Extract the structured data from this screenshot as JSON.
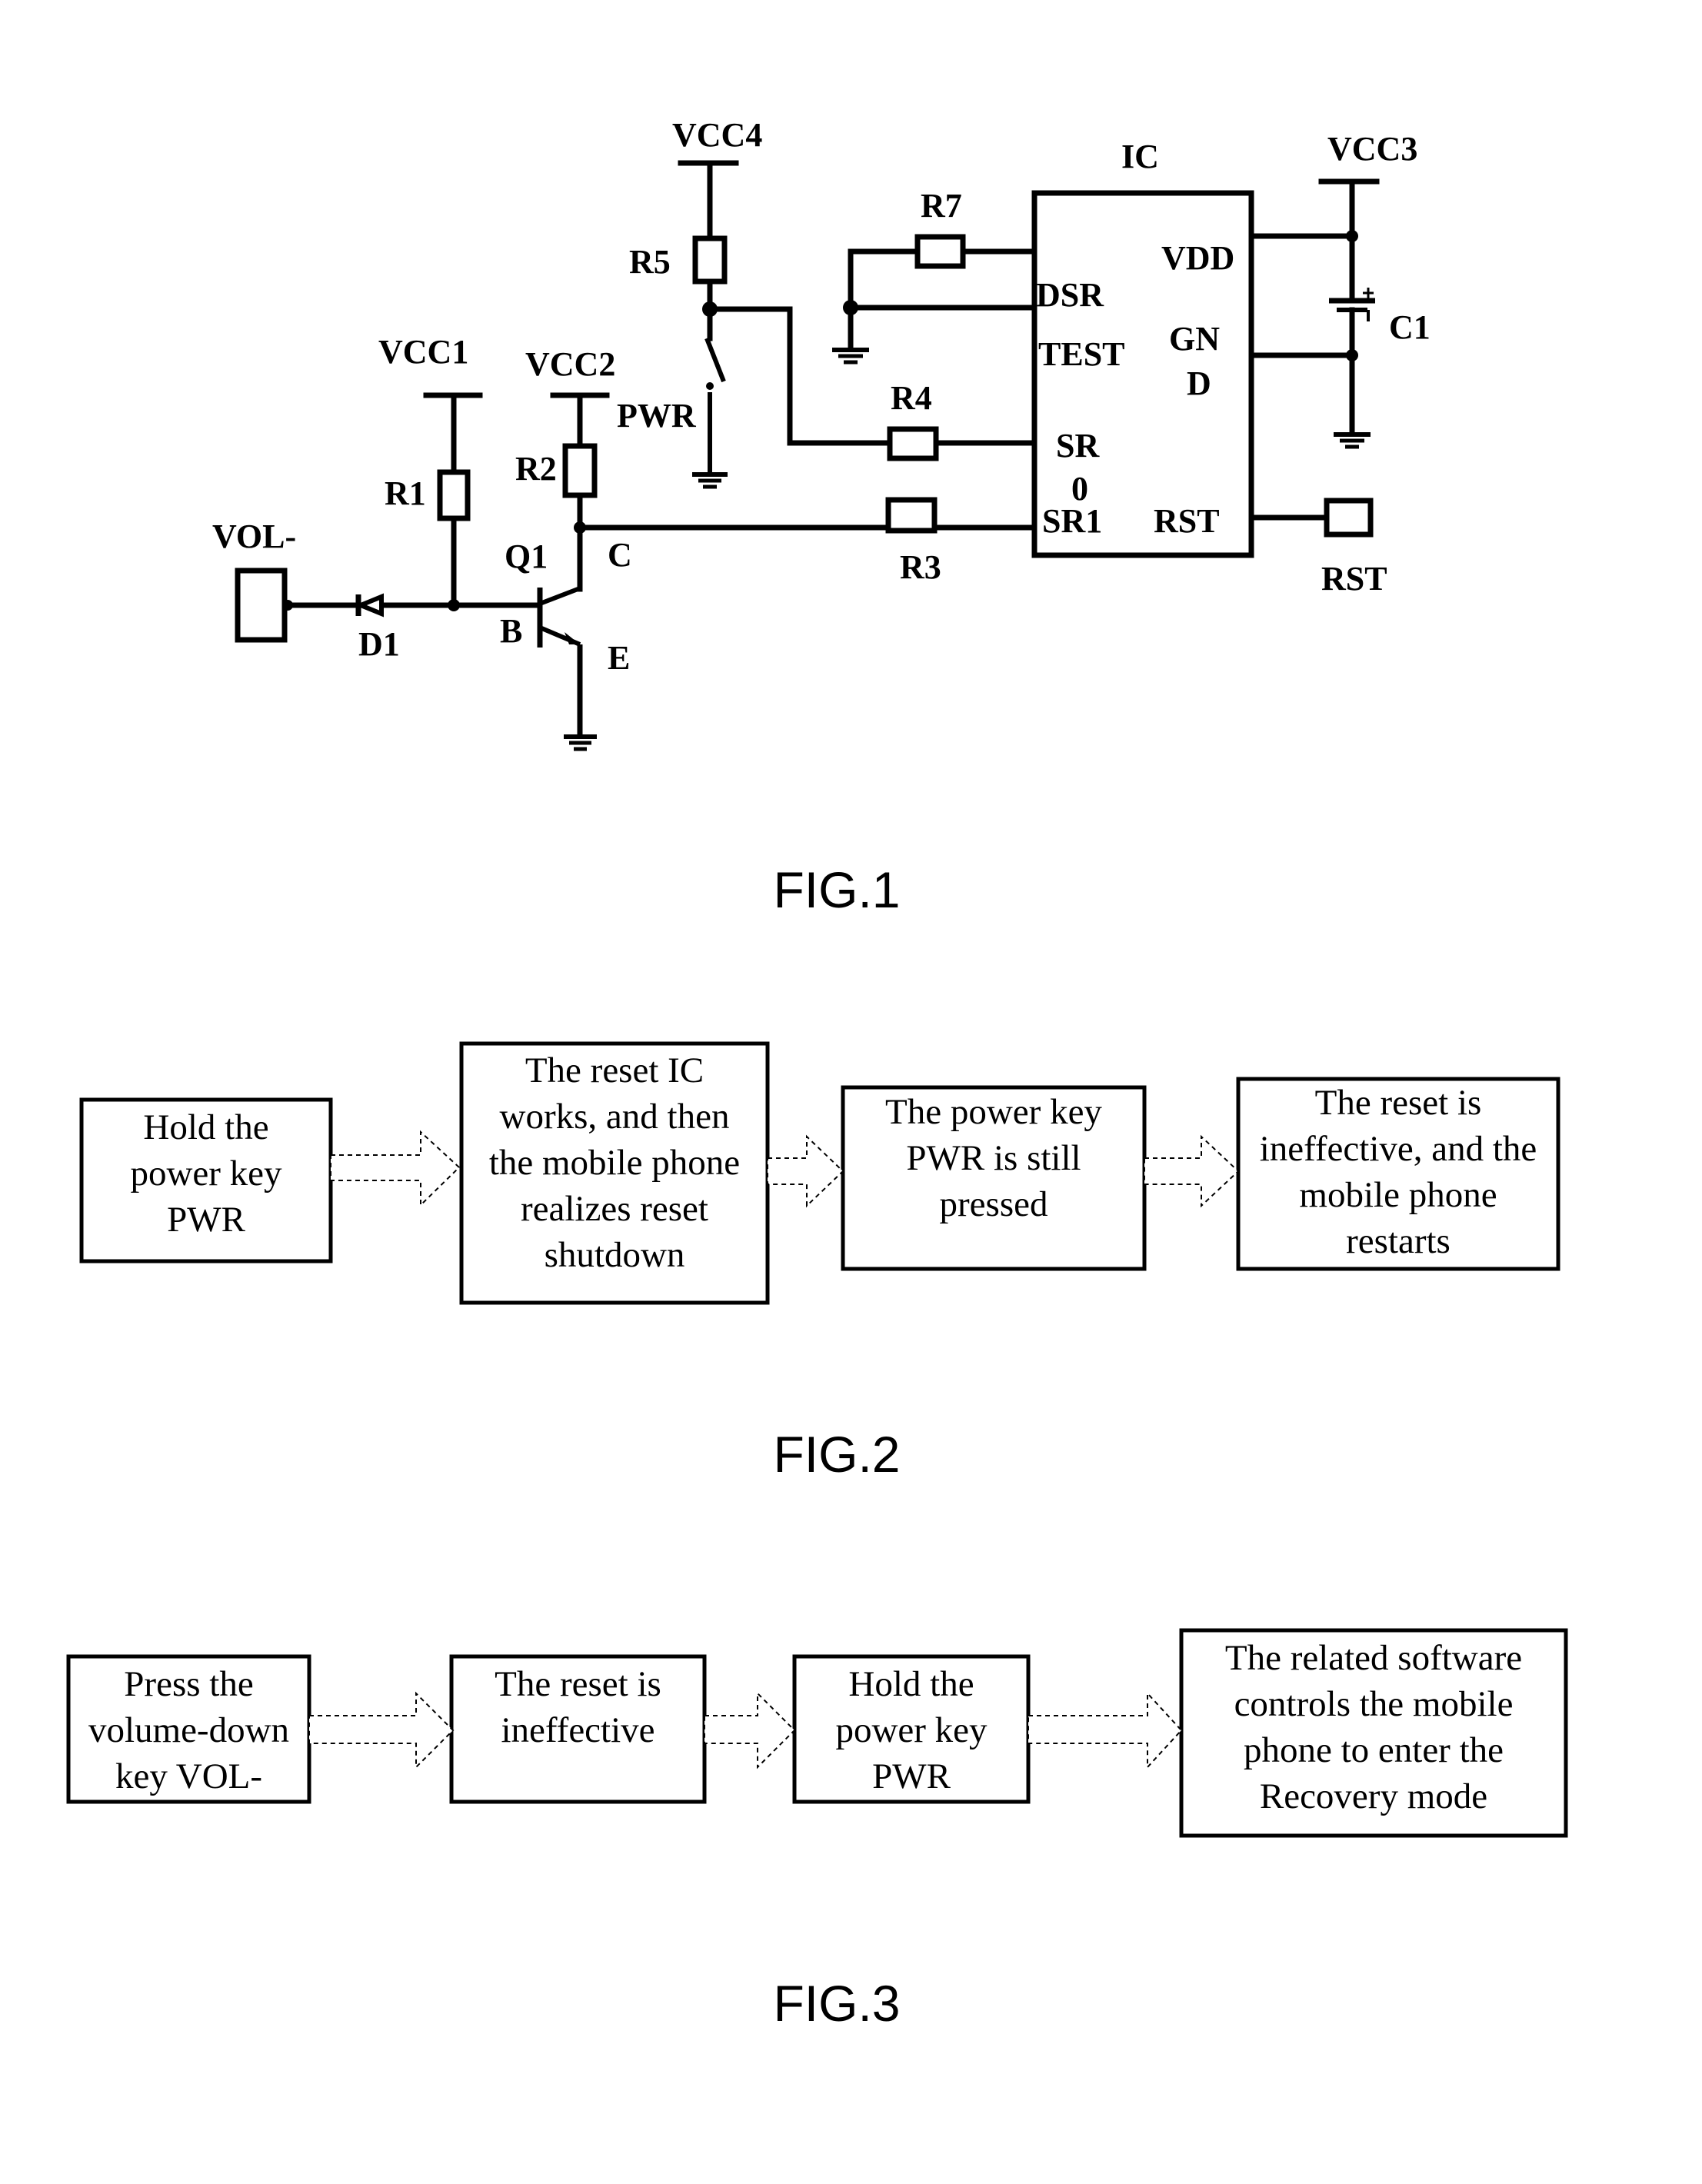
{
  "fig1": {
    "caption": "FIG.1",
    "labels": {
      "vcc1": "VCC1",
      "vcc2": "VCC2",
      "vcc3": "VCC3",
      "vcc4": "VCC4",
      "r1": "R1",
      "r2": "R2",
      "r3": "R3",
      "r4": "R4",
      "r5": "R5",
      "r7": "R7",
      "d1": "D1",
      "q1": "Q1",
      "b": "B",
      "c": "C",
      "e": "E",
      "vol": "VOL-",
      "pwr": "PWR",
      "c1": "C1",
      "rst_out": "RST",
      "ic": "IC"
    },
    "ic_pins": {
      "dsr": "DSR",
      "test": "TEST",
      "sr0_a": "SR",
      "sr0_b": "0",
      "sr1": "SR1",
      "vdd": "VDD",
      "gnd_a": "GN",
      "gnd_b": "D",
      "rst": "RST"
    }
  },
  "fig2": {
    "caption": "FIG.2",
    "steps": [
      [
        "Hold the",
        "power key",
        "PWR"
      ],
      [
        "The reset IC",
        "works, and then",
        "the mobile phone",
        "realizes reset",
        "shutdown"
      ],
      [
        "The power key",
        "PWR is still",
        "pressed"
      ],
      [
        "The reset is",
        "ineffective, and the",
        "mobile phone",
        "restarts"
      ]
    ]
  },
  "fig3": {
    "caption": "FIG.3",
    "steps": [
      [
        "Press the",
        "volume-down",
        "key VOL-"
      ],
      [
        "The reset is",
        "ineffective"
      ],
      [
        "Hold the",
        "power key",
        "PWR"
      ],
      [
        "The related software",
        "controls the mobile",
        "phone to enter the",
        "Recovery mode"
      ]
    ]
  }
}
